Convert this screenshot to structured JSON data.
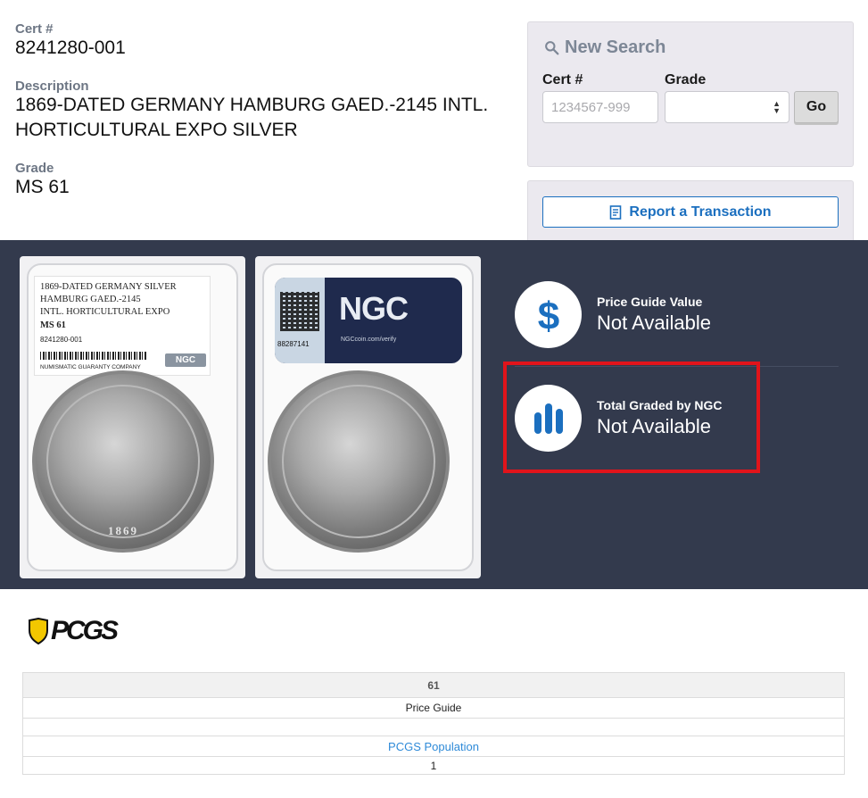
{
  "cert": {
    "label": "Cert #",
    "value": "8241280-001"
  },
  "description": {
    "label": "Description",
    "line1": "1869-DATED GERMANY HAMBURG GAED.-2145 INTL.",
    "line2": "HORTICULTURAL EXPO SILVER"
  },
  "grade": {
    "label": "Grade",
    "value": "MS 61"
  },
  "new_search": {
    "title": "New Search",
    "cert_label": "Cert #",
    "cert_placeholder": "1234567-999",
    "grade_label": "Grade",
    "grade_value": "",
    "go_label": "Go"
  },
  "report": {
    "label": "Report a Transaction"
  },
  "slab_label": {
    "line1": "1869-DATED GERMANY SILVER",
    "line2": "HAMBURG GAED.-2145",
    "line3": "INTL. HORTICULTURAL EXPO",
    "grade": "MS 61",
    "cert": "8241280-001",
    "company": "NUMISMATIC GUARANTY COMPANY",
    "brand": "NGC"
  },
  "slab_back": {
    "brand": "NGC",
    "url": "NGCcoin.com/verify",
    "number": "88287141"
  },
  "coin_front_year": "1869",
  "stats": [
    {
      "title": "Price Guide Value",
      "value": "Not Available",
      "icon": "dollar-icon"
    },
    {
      "title": "Total Graded by NGC",
      "value": "Not Available",
      "icon": "bar-chart-icon"
    }
  ],
  "pcgs": {
    "logo_text": "PCGS",
    "grade": "61",
    "price_guide_label": "Price Guide",
    "price_guide_value": "",
    "population_label": "PCGS Population",
    "population_value": "1"
  },
  "colors": {
    "band": "#333a4d",
    "accent": "#1b6fbf",
    "highlight": "#e1141b",
    "link": "#2e8ad8"
  }
}
